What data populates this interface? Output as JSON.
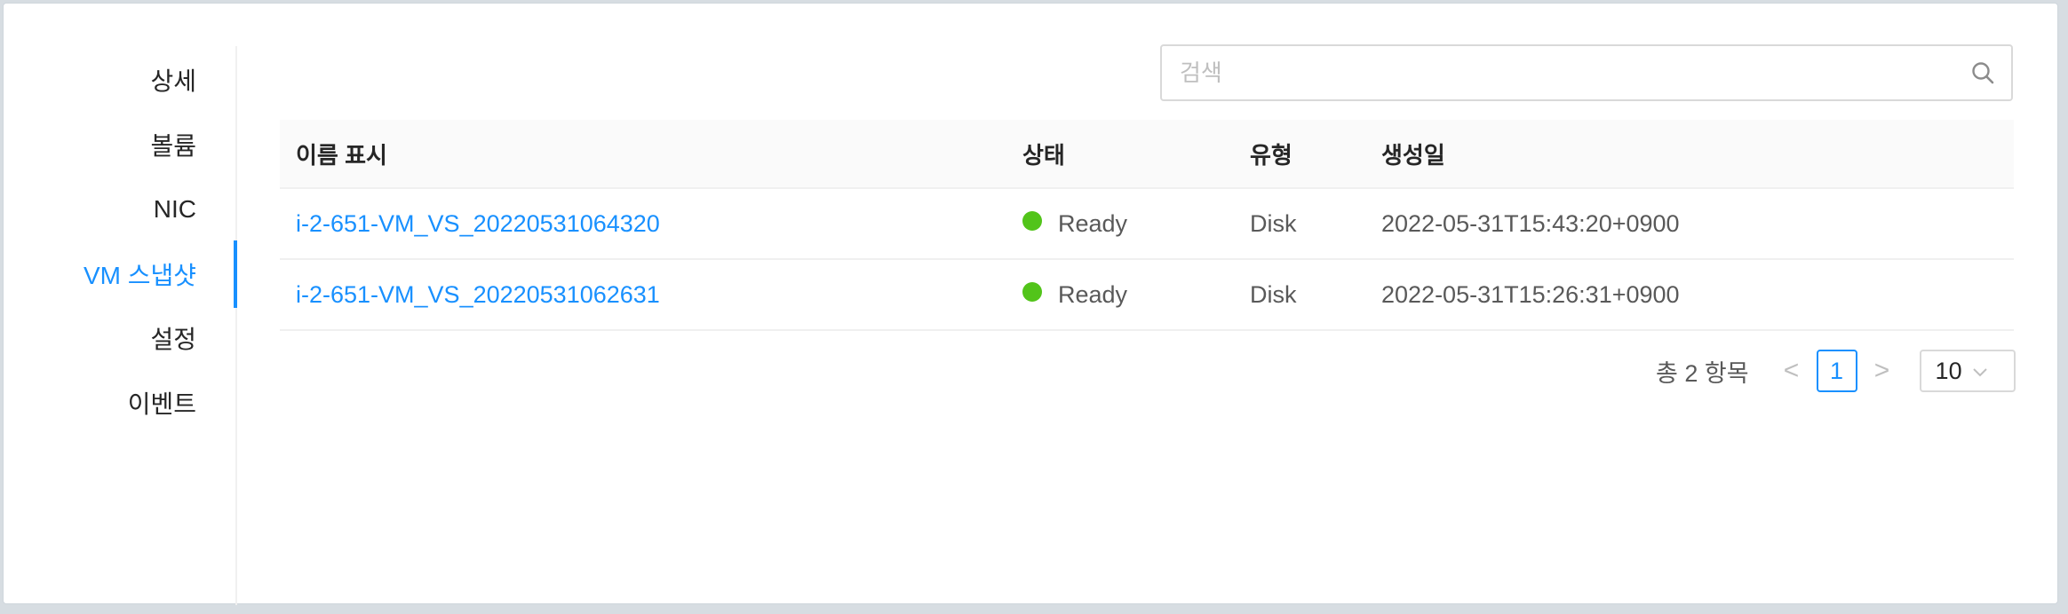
{
  "tabs": [
    {
      "label": "상세",
      "active": false
    },
    {
      "label": "볼륨",
      "active": false
    },
    {
      "label": "NIC",
      "active": false
    },
    {
      "label": "VM 스냅샷",
      "active": true
    },
    {
      "label": "설정",
      "active": false
    },
    {
      "label": "이벤트",
      "active": false
    }
  ],
  "search": {
    "placeholder": "검색",
    "value": "",
    "icon": "search-icon"
  },
  "table": {
    "headers": [
      "이름 표시",
      "상태",
      "유형",
      "생성일"
    ],
    "rows": [
      {
        "name": "i-2-651-VM_VS_20220531064320",
        "status": "Ready",
        "type": "Disk",
        "created": "2022-05-31T15:43:20+0900"
      },
      {
        "name": "i-2-651-VM_VS_20220531062631",
        "status": "Ready",
        "type": "Disk",
        "created": "2022-05-31T15:26:31+0900"
      }
    ]
  },
  "pagination": {
    "total_label": "총 2 항목",
    "prev": "<",
    "current_page": "1",
    "next": ">",
    "page_size": "10"
  },
  "colors": {
    "accent": "#1890ff",
    "ready": "#52c41a"
  }
}
